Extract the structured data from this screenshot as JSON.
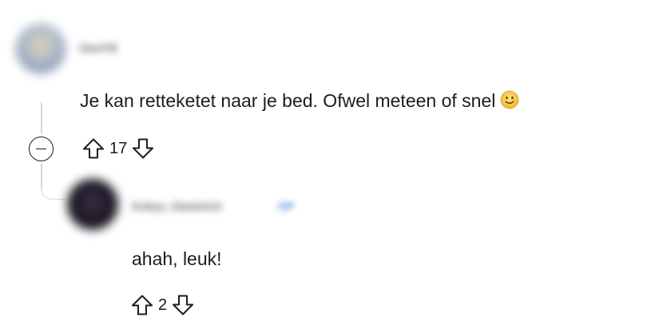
{
  "comments": [
    {
      "username": "DaviTE",
      "body": "Je kan retteketet naar je bed. Ofwel meteen of snel",
      "emoji": "slightly-smiling-face",
      "score": "17"
    },
    {
      "username": "Kokyu_Damieich",
      "flair": "OP",
      "body": "ahah, leuk!",
      "score": "2"
    }
  ],
  "icons": {
    "upvote": "upvote-arrow-icon",
    "downvote": "downvote-arrow-icon",
    "collapse": "minus-circle-icon"
  },
  "colors": {
    "text": "#1c1c1c",
    "thread_line": "#d4d7db",
    "flair": "#4d7fe0",
    "emoji": "#f7c93c"
  }
}
